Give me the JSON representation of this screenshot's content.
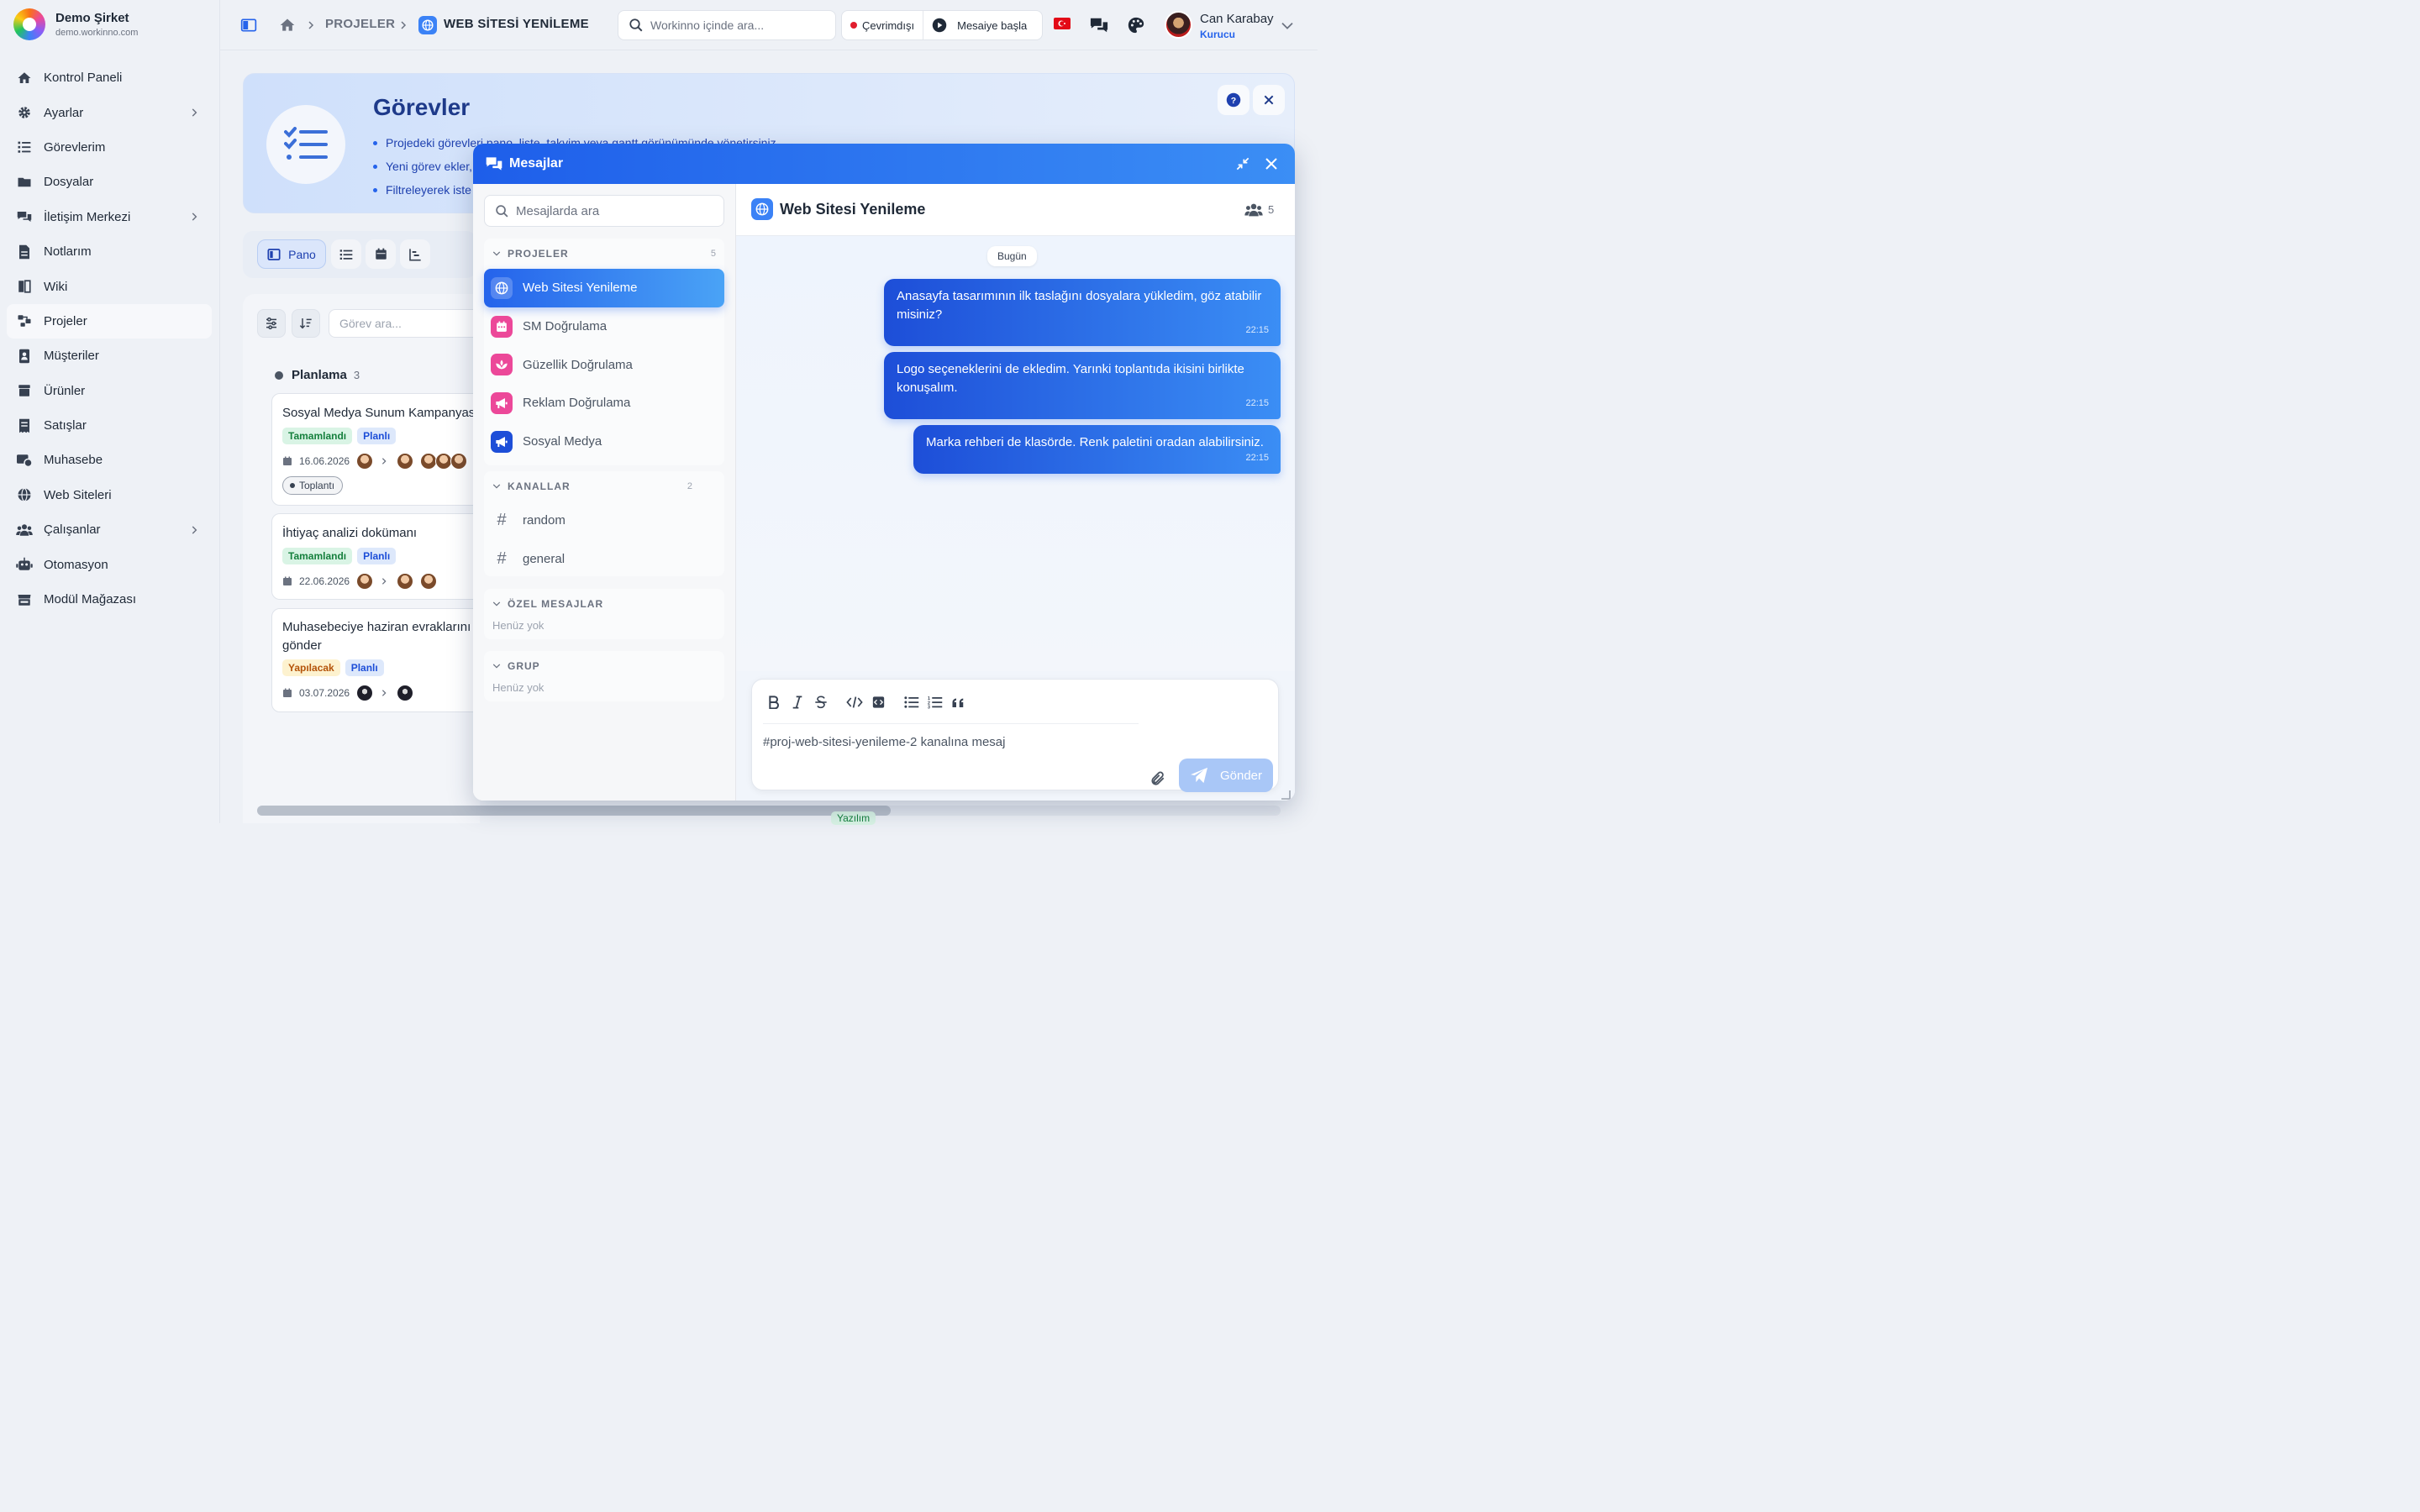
{
  "brand": {
    "name": "Demo Şirket",
    "domain": "demo.workinno.com"
  },
  "sidebar": {
    "items": [
      {
        "label": "Kontrol Paneli",
        "icon": "home-icon"
      },
      {
        "label": "Ayarlar",
        "icon": "gear-icon",
        "has_children": true
      },
      {
        "label": "Görevlerim",
        "icon": "task-list-icon"
      },
      {
        "label": "Dosyalar",
        "icon": "folder-icon"
      },
      {
        "label": "İletişim Merkezi",
        "icon": "chat-icon",
        "has_children": true
      },
      {
        "label": "Notlarım",
        "icon": "note-icon"
      },
      {
        "label": "Wiki",
        "icon": "book-icon"
      },
      {
        "label": "Projeler",
        "icon": "project-icon",
        "active": true
      },
      {
        "label": "Müşteriler",
        "icon": "contact-icon"
      },
      {
        "label": "Ürünler",
        "icon": "box-icon"
      },
      {
        "label": "Satışlar",
        "icon": "receipt-icon"
      },
      {
        "label": "Muhasebe",
        "icon": "accounting-icon"
      },
      {
        "label": "Web Siteleri",
        "icon": "globe-icon"
      },
      {
        "label": "Çalışanlar",
        "icon": "users-icon",
        "has_children": true
      },
      {
        "label": "Otomasyon",
        "icon": "robot-icon"
      },
      {
        "label": "Modül Mağazası",
        "icon": "store-icon"
      }
    ]
  },
  "topbar": {
    "breadcrumb": [
      "PROJELER",
      "WEB SİTESİ YENİLEME"
    ],
    "search_placeholder": "Workinno içinde ara...",
    "status_label": "Çevrimdışı",
    "shift_label": "Mesaiye başla",
    "user_name": "Can Karabay",
    "user_role": "Kurucu"
  },
  "hero": {
    "title": "Görevler",
    "bullets": [
      "Projedeki görevleri pano, liste, takvim veya gantt görünümünde yönetirsiniz.",
      "Yeni görev ekler,",
      "Filtreleyerek iste"
    ]
  },
  "views": {
    "board_label": "Pano"
  },
  "board": {
    "search_placeholder": "Görev ara...",
    "column": {
      "title": "Planlama",
      "count": "3"
    },
    "cards": [
      {
        "title": "Sosyal Medya Sunum Kampanyası",
        "tags": [
          "Tamamlandı",
          "Planlı"
        ],
        "date": "16.06.2026",
        "chip": "Toplantı"
      },
      {
        "title": "İhtiyaç analizi dokümanı",
        "tags": [
          "Tamamlandı",
          "Planlı"
        ],
        "date": "22.06.2026"
      },
      {
        "title": "Muhasebeciye haziran evraklarını gönder",
        "tags": [
          "Yapılacak",
          "Planlı"
        ],
        "date": "03.07.2026"
      }
    ],
    "peek_tag": "Yazılım"
  },
  "messages": {
    "title": "Mesajlar",
    "search_placeholder": "Mesajlarda ara",
    "sections": {
      "projects": {
        "label": "PROJELER",
        "count": "5"
      },
      "channels": {
        "label": "KANALLAR",
        "count": "2"
      },
      "dms": {
        "label": "ÖZEL MESAJLAR",
        "empty": "Henüz yok"
      },
      "group": {
        "label": "GRUP",
        "empty": "Henüz yok"
      }
    },
    "projects": [
      {
        "label": "Web Sitesi Yenileme",
        "color": "#2563eb"
      },
      {
        "label": "SM Doğrulama",
        "color": "#ec4899"
      },
      {
        "label": "Güzellik Doğrulama",
        "color": "#ec4899"
      },
      {
        "label": "Reklam Doğrulama",
        "color": "#ec4899"
      },
      {
        "label": "Sosyal Medya",
        "color": "#1d4ed8"
      }
    ],
    "channels": [
      {
        "label": "random"
      },
      {
        "label": "general"
      }
    ],
    "chat": {
      "title": "Web Sitesi Yenileme",
      "member_count": "5",
      "day": "Bugün",
      "messages": [
        {
          "text": "Anasayfa tasarımının ilk taslağını dosyalara yükledim, göz atabilir misiniz?",
          "time": "22:15"
        },
        {
          "text": "Logo seçeneklerini de ekledim. Yarınki toplantıda ikisini birlikte konuşalım.",
          "time": "22:15"
        },
        {
          "text": "Marka rehberi de klasörde. Renk paletini oradan alabilirsiniz.",
          "time": "22:15"
        }
      ],
      "composer_placeholder": "#proj-web-sitesi-yenileme-2 kanalına mesaj",
      "send_label": "Gönder"
    }
  },
  "colors": {
    "accent": "#2563eb",
    "header_gradient_start": "#1e5eea",
    "header_gradient_end": "#3b8ef5"
  }
}
